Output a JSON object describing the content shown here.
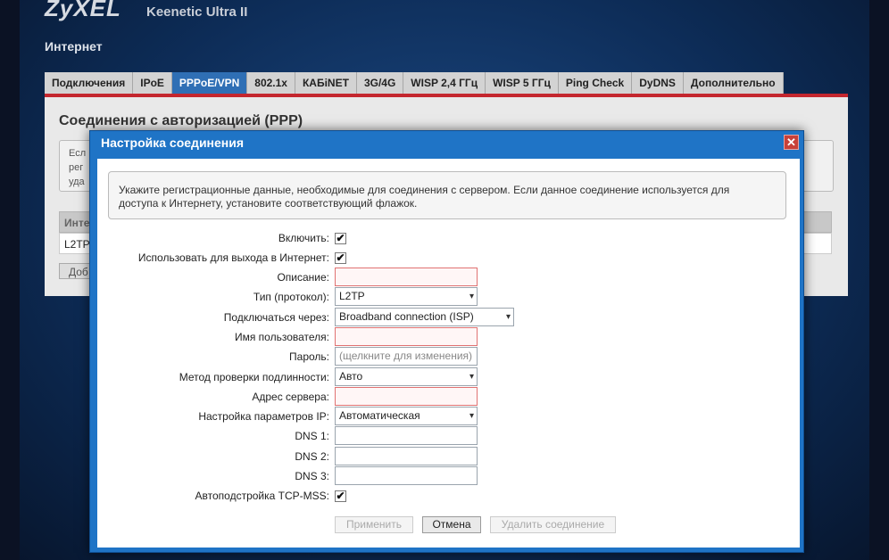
{
  "brand": {
    "logo": "ZyXEL",
    "model": "Keenetic Ultra II"
  },
  "section_title": "Интернет",
  "tabs": [
    {
      "label": "Подключения"
    },
    {
      "label": "IPoE"
    },
    {
      "label": "PPPoE/VPN",
      "active": true
    },
    {
      "label": "802.1x"
    },
    {
      "label": "КАБiNET"
    },
    {
      "label": "3G/4G"
    },
    {
      "label": "WISP 2,4 ГГц"
    },
    {
      "label": "WISP 5 ГГц"
    },
    {
      "label": "Ping Check"
    },
    {
      "label": "DyDNS"
    },
    {
      "label": "Дополнительно"
    }
  ],
  "background_panel": {
    "heading": "Соединения с авторизацией (PPP)",
    "info_lines": [
      "Есл",
      "рег",
      "уда"
    ],
    "table_header": "Инте",
    "table_row": "L2TP",
    "add_button": "Доб"
  },
  "dialog": {
    "title": "Настройка соединения",
    "close_glyph": "✕",
    "note_line1": "Укажите регистрационные данные, необходимые для соединения с сервером. Если данное соединение используется для",
    "note_line2": "доступа к Интернету, установите соответствующий флажок.",
    "fields": {
      "enable": {
        "label": "Включить:",
        "checked": true
      },
      "internet": {
        "label": "Использовать для выхода в Интернет:",
        "checked": true
      },
      "description": {
        "label": "Описание:",
        "value": ""
      },
      "type": {
        "label": "Тип (протокол):",
        "value": "L2TP"
      },
      "via": {
        "label": "Подключаться через:",
        "value": "Broadband connection (ISP)"
      },
      "username": {
        "label": "Имя пользователя:",
        "value": ""
      },
      "password": {
        "label": "Пароль:",
        "value": "(щелкните для изменения)"
      },
      "auth": {
        "label": "Метод проверки подлинности:",
        "value": "Авто"
      },
      "server": {
        "label": "Адрес сервера:",
        "value": ""
      },
      "ip": {
        "label": "Настройка параметров IP:",
        "value": "Автоматическая"
      },
      "dns1": {
        "label": "DNS 1:",
        "value": ""
      },
      "dns2": {
        "label": "DNS 2:",
        "value": ""
      },
      "dns3": {
        "label": "DNS 3:",
        "value": ""
      },
      "mss": {
        "label": "Автоподстройка TCP-MSS:",
        "checked": true
      }
    },
    "check_glyph": "✔",
    "arrow_glyph": "▾",
    "buttons": {
      "apply": "Применить",
      "cancel": "Отмена",
      "delete": "Удалить соединение"
    }
  },
  "colors": {
    "active_tab": "#2f6fb5",
    "dialog_header": "#1f74c6",
    "tab_underline": "#c4262e",
    "required_border": "#e07272"
  }
}
